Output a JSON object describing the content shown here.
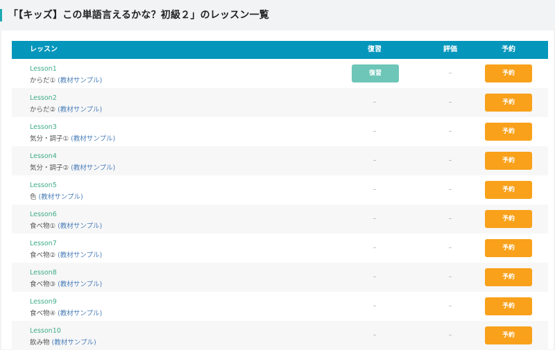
{
  "page": {
    "title": "「【キッズ】この単語言えるかな？初級２」のレッスン一覧"
  },
  "table": {
    "headers": {
      "lesson": "レッスン",
      "review": "復習",
      "rating": "評価",
      "reserve": "予約"
    },
    "review_label": "復習",
    "reserve_label": "予約",
    "dash": "–",
    "sample_label": "(教材サンプル)",
    "rows": [
      {
        "name": "Lesson1",
        "desc": "からだ①",
        "review_button": true
      },
      {
        "name": "Lesson2",
        "desc": "からだ②",
        "review_button": false
      },
      {
        "name": "Lesson3",
        "desc": "気分・調子①",
        "review_button": false
      },
      {
        "name": "Lesson4",
        "desc": "気分・調子②",
        "review_button": false
      },
      {
        "name": "Lesson5",
        "desc": "色",
        "review_button": false
      },
      {
        "name": "Lesson6",
        "desc": "食べ物①",
        "review_button": false
      },
      {
        "name": "Lesson7",
        "desc": "食べ物②",
        "review_button": false
      },
      {
        "name": "Lesson8",
        "desc": "食べ物③",
        "review_button": false
      },
      {
        "name": "Lesson9",
        "desc": "食べ物④",
        "review_button": false
      },
      {
        "name": "Lesson10",
        "desc": "飲み物",
        "review_button": false
      }
    ]
  },
  "colors": {
    "header_bg": "#0596bc",
    "accent_bar": "#1ba9b2",
    "lesson_link": "#3dac86",
    "sample_link": "#4a7eb8",
    "review_button": "#6dc6b8",
    "reserve_button": "#f9a11b"
  }
}
